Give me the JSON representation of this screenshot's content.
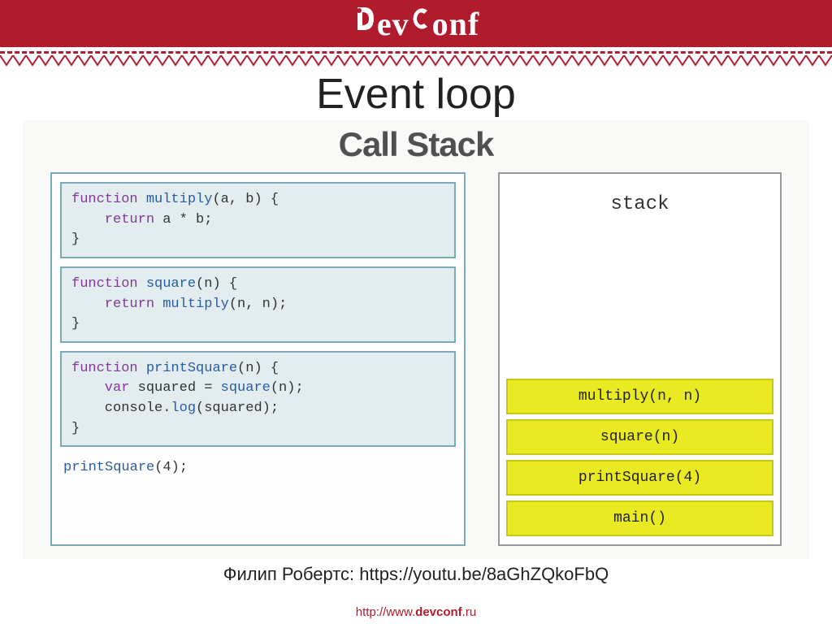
{
  "header": {
    "logo_d": "D",
    "logo_ev": "ev",
    "logo_c": "C",
    "logo_onf": "onf"
  },
  "slide": {
    "title": "Event loop",
    "diagram_title": "Call Stack"
  },
  "code": {
    "block1_l1_kw": "function",
    "block1_l1_fn": " multiply",
    "block1_l1_params": "(a, b) {",
    "block1_l2_kw": "    return",
    "block1_l2_expr": " a * b;",
    "block1_l3": "}",
    "block2_l1_kw": "function",
    "block2_l1_fn": " square",
    "block2_l1_params": "(n) {",
    "block2_l2_kw": "    return",
    "block2_l2_fn": " multiply",
    "block2_l2_args": "(n, n);",
    "block2_l3": "}",
    "block3_l1_kw": "function",
    "block3_l1_fn": " printSquare",
    "block3_l1_params": "(n) {",
    "block3_l2_kw": "    var",
    "block3_l2_var": " squared = ",
    "block3_l2_fn": "square",
    "block3_l2_args": "(n);",
    "block3_l3_obj": "    console.",
    "block3_l3_fn": "log",
    "block3_l3_args": "(squared);",
    "block3_l4": "}",
    "call_fn": "printSquare",
    "call_args": "(4);"
  },
  "stack": {
    "label": "stack",
    "items": [
      "multiply(n, n)",
      "square(n)",
      "printSquare(4)",
      "main()"
    ]
  },
  "credit": "Филип Робертс: https://youtu.be/8aGhZQkoFbQ",
  "footer": {
    "pre": "http://www.",
    "bold": "devconf",
    "post": ".ru"
  }
}
